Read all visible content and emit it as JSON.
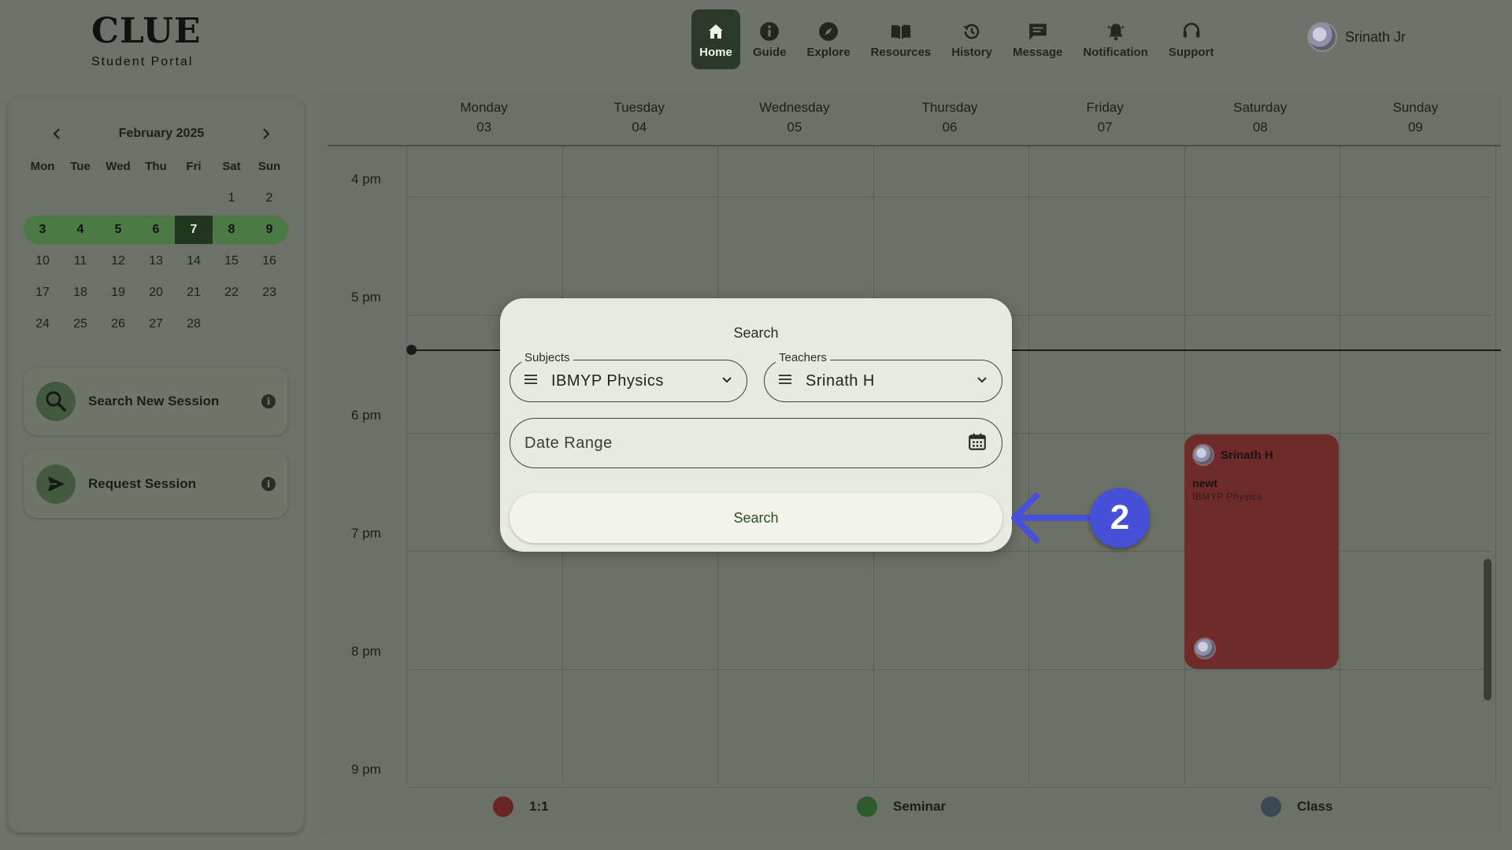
{
  "brand": {
    "title": "CLUE",
    "subtitle": "Student Portal"
  },
  "nav": [
    {
      "label": "Home",
      "icon": "home-icon",
      "active": true
    },
    {
      "label": "Guide",
      "icon": "info-icon"
    },
    {
      "label": "Explore",
      "icon": "compass-icon"
    },
    {
      "label": "Resources",
      "icon": "book-icon"
    },
    {
      "label": "History",
      "icon": "history-icon"
    },
    {
      "label": "Message",
      "icon": "message-icon"
    },
    {
      "label": "Notification",
      "icon": "bell-icon"
    },
    {
      "label": "Support",
      "icon": "headset-icon"
    }
  ],
  "user": {
    "name": "Srinath Jr"
  },
  "mini_calendar": {
    "month": "February 2025",
    "dow": [
      "Mon",
      "Tue",
      "Wed",
      "Thu",
      "Fri",
      "Sat",
      "Sun"
    ],
    "weeks": [
      [
        "",
        "",
        "",
        "",
        "",
        "1",
        "2"
      ],
      [
        "3",
        "4",
        "5",
        "6",
        "7",
        "8",
        "9"
      ],
      [
        "10",
        "11",
        "12",
        "13",
        "14",
        "15",
        "16"
      ],
      [
        "17",
        "18",
        "19",
        "20",
        "21",
        "22",
        "23"
      ],
      [
        "24",
        "25",
        "26",
        "27",
        "28",
        "",
        ""
      ]
    ],
    "selected_week_index": 1,
    "today": "7"
  },
  "side_actions": {
    "search": "Search New Session",
    "request": "Request Session",
    "info_glyph": "i"
  },
  "week_days": [
    {
      "name": "Monday",
      "date": "03"
    },
    {
      "name": "Tuesday",
      "date": "04"
    },
    {
      "name": "Wednesday",
      "date": "05"
    },
    {
      "name": "Thursday",
      "date": "06"
    },
    {
      "name": "Friday",
      "date": "07"
    },
    {
      "name": "Saturday",
      "date": "08"
    },
    {
      "name": "Sunday",
      "date": "09"
    }
  ],
  "time_labels": [
    "4 pm",
    "5 pm",
    "6 pm",
    "7 pm",
    "8 pm",
    "9 pm"
  ],
  "event": {
    "teacher": "Srinath H",
    "title": "newt",
    "subject": "IBMYP Physics",
    "color": "#6f2b29"
  },
  "legend": [
    {
      "label": "1:1",
      "color": "#6a2624"
    },
    {
      "label": "Seminar",
      "color": "#2f5a2d"
    },
    {
      "label": "Class",
      "color": "#3b4753"
    }
  ],
  "modal": {
    "title": "Search",
    "subjects_label": "Subjects",
    "subjects_value": "IBMYP Physics",
    "teachers_label": "Teachers",
    "teachers_value": "Srinath H",
    "date_placeholder": "Date Range",
    "search_button": "Search"
  },
  "annotation": {
    "step": "2",
    "color": "#4750d8"
  }
}
